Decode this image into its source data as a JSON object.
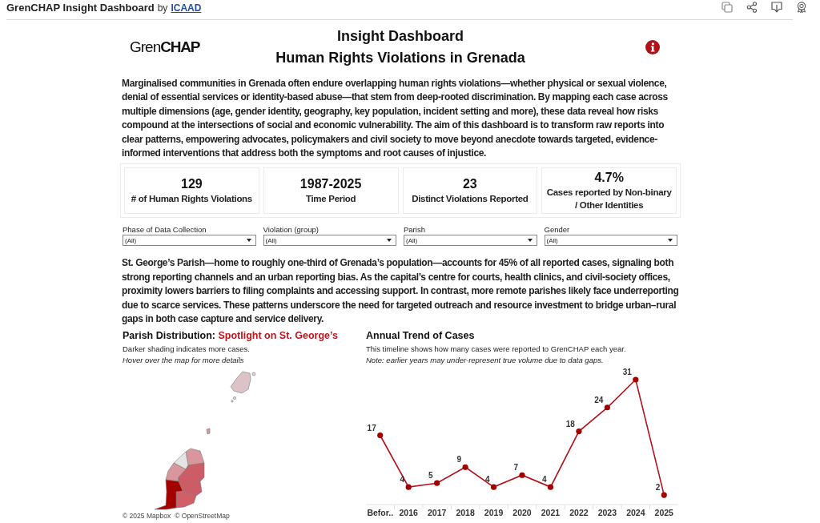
{
  "topbar": {
    "title": "GrenCHAP Insight Dashboard",
    "by": "by",
    "author": "ICAAD"
  },
  "header": {
    "logo": "Gren**CHAP**",
    "title": "Insight Dashboard",
    "subtitle": "Human Rights Violations in Grenada"
  },
  "intro": "Marginalised communities in Grenada often endure overlapping human rights violations—whether physical or sexual violence, denial of essential services or identity-based abuse—that stem from deep-rooted discrimination. By mapping each case across multiple dimensions (age, gender identity, geography, key population, incident setting and more), these data reveal how risks compound at the intersections of social and economic vulnerability. The aim of this dashboard is to transform raw reports into clear patterns, empowering advocates, policymakers and civil society to move beyond anecdote towards targeted, evidence-informed interventions that address both the symptoms and root causes of injustice.",
  "kpis": [
    {
      "value": "129",
      "label": "# of Human Rights Violations"
    },
    {
      "value": "1987-2025",
      "label": "Time Period"
    },
    {
      "value": "23",
      "label": "Distinct Violations Reported"
    },
    {
      "value": "4.7%",
      "label": "Cases reported by Non-binary / Other Identities"
    }
  ],
  "filters": [
    {
      "label": "Phase of Data Collection",
      "value": "(All)"
    },
    {
      "label": "Violation (group)",
      "value": "(All)"
    },
    {
      "label": "Parish",
      "value": "(All)"
    },
    {
      "label": "Gender",
      "value": "(All)"
    }
  ],
  "summary": "St. George’s Parish—home to roughly one-third of Grenada’s population—accounts for 45% of all reported cases, signaling both strong reporting channels and an urban reporting bias. As the capital’s centre for courts, health clinics, and civil-society offices, proximity lowers barriers to filing complaints and accessing support. In contrast, more remote parishes likely face underreporting due to scarce services. These patterns underscore the need for targeted outreach and resource investment to bridge urban–rural gaps in both case capture and service delivery.",
  "parish_map": {
    "title": "Parish Distribution:",
    "highlight": "Spotlight on St. George’s",
    "subtitle": "Darker shading indicates more cases.",
    "hint": "Hover over the map for more details",
    "attribution": [
      "© 2025 Mapbox",
      "© OpenStreetMap"
    ]
  },
  "annual_trend": {
    "subtitle": "This timeline shows how many cases were reported to GrenCHAP each year.",
    "note": "Note: earlier years may under-represent true volume due to data gaps.",
    "chart_data": {
      "type": "line",
      "title": "Annual Trend of Cases",
      "categories": [
        "Befor..",
        "2016",
        "2017",
        "2018",
        "2019",
        "2020",
        "2021",
        "2022",
        "2023",
        "2024",
        "2025"
      ],
      "values": [
        17,
        4,
        5,
        9,
        4,
        7,
        4,
        18,
        24,
        31,
        2
      ],
      "marker": true,
      "data_labels": true
    }
  }
}
